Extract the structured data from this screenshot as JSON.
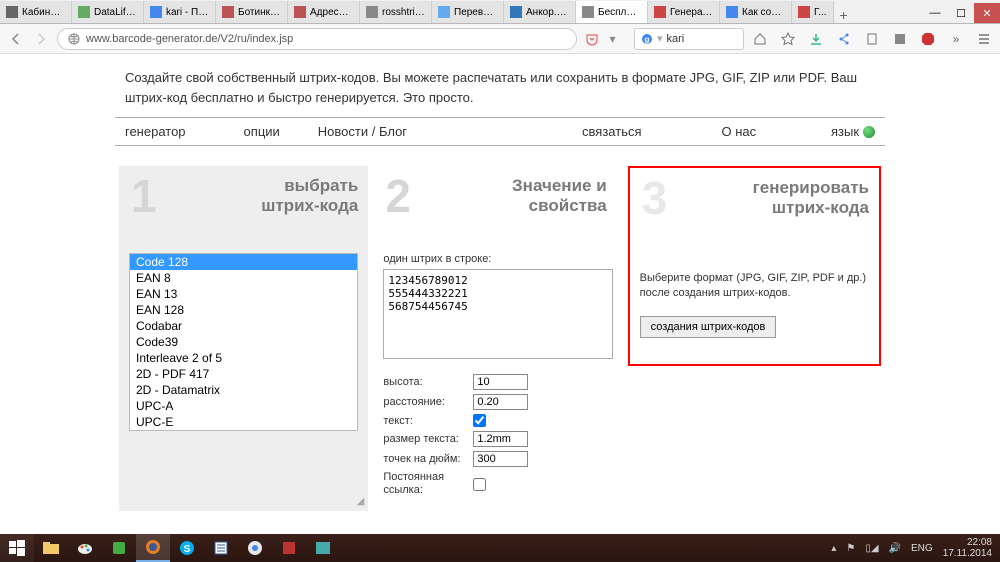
{
  "browser": {
    "tabs": [
      {
        "label": "Кабинет |..."
      },
      {
        "label": "DataLife ..."
      },
      {
        "label": "kari - По..."
      },
      {
        "label": "Ботинки ..."
      },
      {
        "label": "Адреса м..."
      },
      {
        "label": "rosshtrih..."
      },
      {
        "label": "Перевод..."
      },
      {
        "label": "Анкор. К..."
      },
      {
        "label": "Бесплатн..."
      },
      {
        "label": "Генерато..."
      },
      {
        "label": "Как созд..."
      },
      {
        "label": "Г..."
      }
    ],
    "active_tab_index": 8,
    "url": "www.barcode-generator.de/V2/ru/index.jsp",
    "search_query": "kari"
  },
  "page": {
    "intro": "Создайте свой собственный штрих-кодов. Вы можете распечатать или сохранить в формате JPG, GIF, ZIP или PDF. Ваш штрих-код бесплатно и быстро генерируется. Это просто.",
    "nav": {
      "generator": "генератор",
      "options": "опции",
      "news": "Новости / Блог",
      "contact": "связаться",
      "about": "О нас",
      "language": "язык"
    },
    "col1": {
      "num": "1",
      "title_l1": "выбрать",
      "title_l2": "штрих-кода",
      "options": [
        "Code 128",
        "EAN 8",
        "EAN 13",
        "EAN 128",
        "Codabar",
        "Code39",
        "Interleave 2 of 5",
        "2D - PDF 417",
        "2D - Datamatrix",
        "UPC-A",
        "UPC-E"
      ],
      "selected_index": 0
    },
    "col2": {
      "num": "2",
      "title_l1": "Значение и",
      "title_l2": "свойства",
      "hint": "один штрих в строке:",
      "textarea": "123456789012\n555444332221\n568754456745",
      "height_label": "высота:",
      "height_value": "10",
      "distance_label": "расстояние:",
      "distance_value": "0.20",
      "text_label": "текст:",
      "text_checked": true,
      "textsize_label": "размер текста:",
      "textsize_value": "1.2mm",
      "dpi_label": "точек на дюйм:",
      "dpi_value": "300",
      "permalink_label": "Постоянная ссылка:",
      "permalink_checked": false
    },
    "col3": {
      "num": "3",
      "title_l1": "генерировать",
      "title_l2": "штрих-кода",
      "desc": "Выберите формат (JPG, GIF, ZIP, PDF и др.) после создания штрих-кодов.",
      "button": "создания штрих-кодов"
    }
  },
  "taskbar": {
    "lang": "ENG",
    "time": "22:08",
    "date": "17.11.2014"
  }
}
